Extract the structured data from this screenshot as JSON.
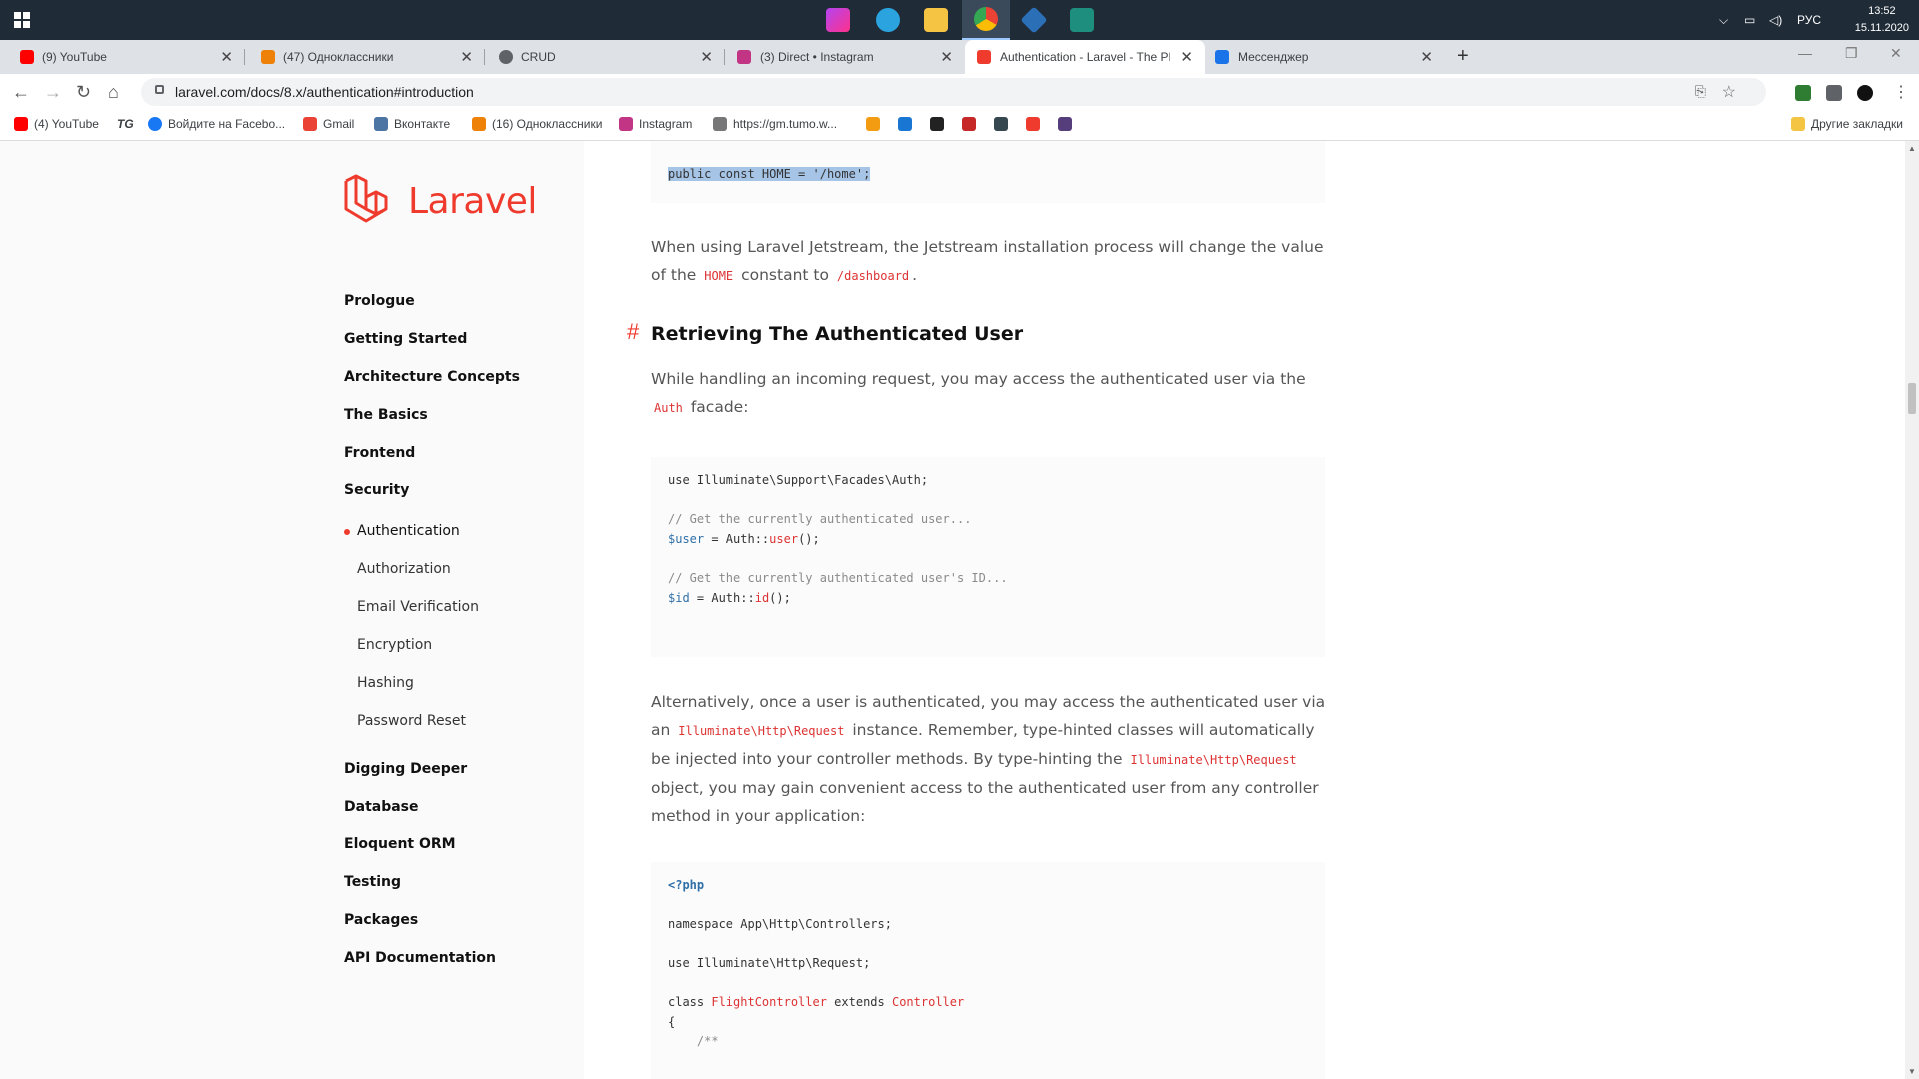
{
  "taskbar": {
    "apps": [
      "phpstorm-icon",
      "telegram-icon",
      "file-explorer-icon",
      "chrome-icon",
      "git-kraken-icon",
      "terminal-icon"
    ],
    "lang": "РУС",
    "time": "13:52",
    "date": "15.11.2020"
  },
  "tabs": [
    {
      "label": "(9) YouTube",
      "color": "#ff0000"
    },
    {
      "label": "(47) Одноклассники",
      "color": "#ee8208"
    },
    {
      "label": "CRUD",
      "color": "#5f6368"
    },
    {
      "label": "(3) Direct • Instagram",
      "color": "#c13584"
    },
    {
      "label": "Authentication - Laravel - The PH",
      "color": "#ef3b2d"
    },
    {
      "label": "Мессенджер",
      "color": "#1a73e8"
    }
  ],
  "address": {
    "url": "laravel.com/docs/8.x/authentication#introduction"
  },
  "bookmarks": [
    {
      "label": "(4) YouTube",
      "color": "#ff0000"
    },
    {
      "label": "TG",
      "color": "#222222"
    },
    {
      "label": "Войдите на Facebo...",
      "color": "#1877f2"
    },
    {
      "label": "Gmail",
      "color": "#ea4335"
    },
    {
      "label": "Вконтакте",
      "color": "#4c75a3"
    },
    {
      "label": "(16) Одноклассники",
      "color": "#ee8208"
    },
    {
      "label": "Instagram",
      "color": "#c13584"
    },
    {
      "label": "https://gm.tumo.w...",
      "color": "#555555"
    }
  ],
  "other_bookmarks": "Другие закладки",
  "sidebar": {
    "logo": "Laravel",
    "sections": [
      "Prologue",
      "Getting Started",
      "Architecture Concepts",
      "The Basics",
      "Frontend",
      "Security"
    ],
    "security_items": [
      "Authentication",
      "Authorization",
      "Email Verification",
      "Encryption",
      "Hashing",
      "Password Reset"
    ],
    "sections_after": [
      "Digging Deeper",
      "Database",
      "Eloquent ORM",
      "Testing",
      "Packages",
      "API Documentation"
    ]
  },
  "content": {
    "code1": "public const HOME = '/home';",
    "p1_a": "When using Laravel Jetstream, the Jetstream installation process will change the value of the",
    "p1_code1": "HOME",
    "p1_b": "constant to",
    "p1_code2": "/dashboard",
    "p1_c": ".",
    "heading": "Retrieving The Authenticated User",
    "hash": "#",
    "p2_a": "While handling an incoming request, you may access the authenticated user via the",
    "p2_code": "Auth",
    "p2_b": "facade:",
    "code2": {
      "l1": "use Illuminate\\Support\\Facades\\Auth;",
      "l2": "// Get the currently authenticated user...",
      "l3a": "$user",
      "l3b": " = Auth::",
      "l3c": "user",
      "l3d": "();",
      "l4": "// Get the currently authenticated user's ID...",
      "l5a": "$id",
      "l5b": " = Auth::",
      "l5c": "id",
      "l5d": "();"
    },
    "p3_a": "Alternatively, once a user is authenticated, you may access the authenticated user via an",
    "p3_code1": "Illuminate\\Http\\Request",
    "p3_b": "instance. Remember, type-hinted classes will automatically be injected into your controller methods. By type-hinting the",
    "p3_code2": "Illuminate\\Http\\Request",
    "p3_c": "object, you may gain convenient access to the authenticated user from any controller method in your application:",
    "code3": {
      "l1": "<?php",
      "l2": "namespace App\\Http\\Controllers;",
      "l3": "use Illuminate\\Http\\Request;",
      "l4a": "class ",
      "l4b": "FlightController",
      "l4c": " extends ",
      "l4d": "Controller",
      "l5": "{",
      "l6": "    /**"
    }
  }
}
